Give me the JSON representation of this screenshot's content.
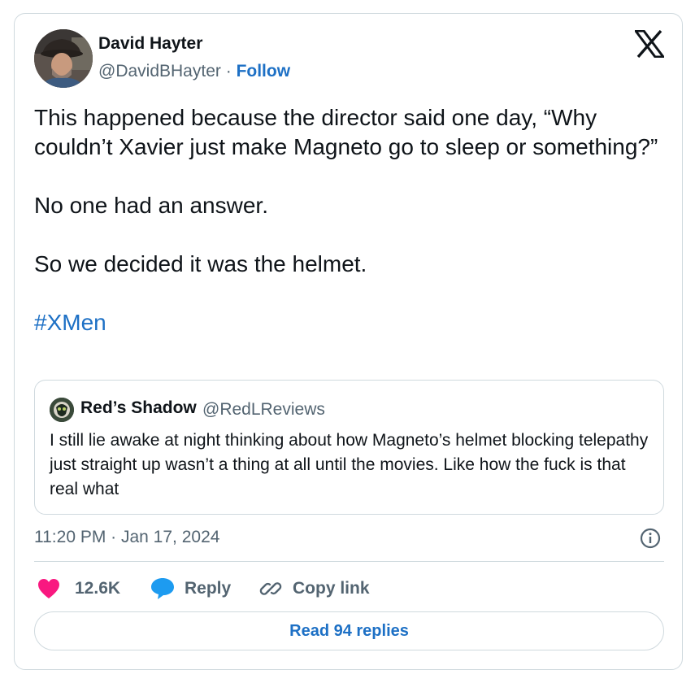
{
  "author": {
    "name": "David Hayter",
    "handle": "@DavidBHayter",
    "separator": "·",
    "follow_label": "Follow"
  },
  "tweet": {
    "lines": [
      "This happened because the director said one day, “Why couldn’t Xavier just make Magneto go to sleep or something?”",
      "No one had an answer.",
      "So we decided it was the helmet."
    ],
    "hashtag": "#XMen"
  },
  "quoted_tweet": {
    "name": "Red’s Shadow",
    "handle": "@RedLReviews",
    "text": "I still lie awake at night thinking about how Magneto’s helmet blocking telepathy just straight up wasn’t a thing at all until the movies. Like how the fuck is that real what"
  },
  "timestamp": "11:20 PM · Jan 17, 2024",
  "actions": {
    "likes_count": "12.6K",
    "reply_label": "Reply",
    "copy_link_label": "Copy link"
  },
  "read_replies_label": "Read 94 replies",
  "icons": {
    "logo": "x-logo-icon",
    "like": "heart-icon",
    "reply": "speech-bubble-icon",
    "copy": "link-icon",
    "info": "info-icon"
  },
  "colors": {
    "accent": "#1d70c5",
    "like": "#f91880",
    "reply": "#1d9bf0",
    "muted": "#536471",
    "border": "#cfd9de"
  }
}
